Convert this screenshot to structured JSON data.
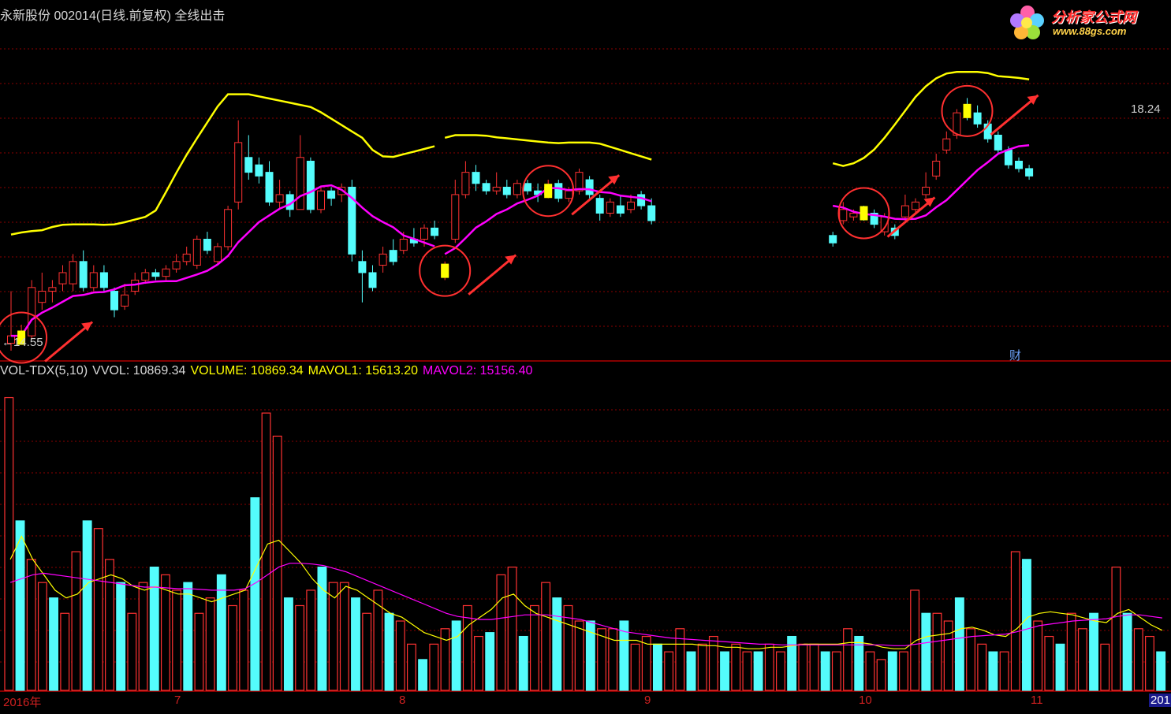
{
  "header": {
    "title": "永新股份 002014(日线.前复权) 全线出击"
  },
  "logo": {
    "name": "分析家公式网",
    "url": "www.88gs.com"
  },
  "price_labels": {
    "low": "←14.55",
    "high": "18.24"
  },
  "badge": "财",
  "vol_header": {
    "name": "VOL-TDX(5,10)",
    "vvol": "VVOL: 10869.34",
    "volume": "VOLUME: 10869.34",
    "mavol1": "MAVOL1: 15613.20",
    "mavol2": "MAVOL2: 15156.40"
  },
  "x_labels": [
    "2016年",
    "7",
    "8",
    "9",
    "10",
    "11",
    "201"
  ],
  "colors": {
    "background": "#000000",
    "up": "#ff3232",
    "down": "#54fcfc",
    "yellow_line": "#ffff00",
    "magenta_line": "#ff00ff",
    "signal": "#ffff00",
    "grid": "#8b0000",
    "volume_name": "#d8d8d8",
    "volume_value": "#ffff00",
    "mavol1": "#ffff00",
    "mavol2": "#ff00ff"
  },
  "chart_data": [
    {
      "type": "candlestick",
      "title": "永新股份 002014(日线.前复权) 全线出击",
      "ylim": [
        14.4,
        18.8
      ],
      "annotated_low": 14.55,
      "annotated_high": 18.24,
      "candles": [
        [
          14.5,
          14.6,
          15.2,
          14.4
        ],
        [
          14.55,
          14.6,
          14.75,
          14.55
        ],
        [
          14.6,
          15.25,
          15.35,
          14.55
        ],
        [
          15.05,
          15.2,
          15.45,
          14.95
        ],
        [
          15.2,
          15.25,
          15.35,
          15.05
        ],
        [
          15.3,
          15.45,
          15.55,
          15.2
        ],
        [
          15.3,
          15.6,
          15.7,
          15.2
        ],
        [
          15.6,
          15.25,
          15.75,
          15.2
        ],
        [
          15.25,
          15.45,
          15.55,
          15.2
        ],
        [
          15.45,
          15.25,
          15.55,
          15.2
        ],
        [
          15.2,
          14.95,
          15.25,
          14.85
        ],
        [
          15.0,
          15.15,
          15.3,
          14.95
        ],
        [
          15.2,
          15.35,
          15.45,
          15.15
        ],
        [
          15.35,
          15.45,
          15.5,
          15.3
        ],
        [
          15.45,
          15.4,
          15.5,
          15.35
        ],
        [
          15.4,
          15.5,
          15.55,
          15.35
        ],
        [
          15.5,
          15.6,
          15.7,
          15.45
        ],
        [
          15.6,
          15.7,
          15.8,
          15.55
        ],
        [
          15.55,
          15.9,
          15.95,
          15.5
        ],
        [
          15.9,
          15.75,
          16.0,
          15.7
        ],
        [
          15.6,
          15.8,
          15.85,
          15.55
        ],
        [
          15.8,
          16.3,
          16.35,
          15.75
        ],
        [
          16.4,
          17.2,
          17.5,
          16.3
        ],
        [
          17.0,
          16.8,
          17.3,
          16.7
        ],
        [
          16.9,
          16.75,
          17.0,
          16.65
        ],
        [
          16.8,
          16.4,
          16.95,
          16.35
        ],
        [
          16.4,
          16.5,
          16.7,
          16.3
        ],
        [
          16.5,
          16.3,
          16.55,
          16.2
        ],
        [
          16.3,
          17.0,
          17.3,
          16.3
        ],
        [
          16.95,
          16.3,
          17.0,
          16.25
        ],
        [
          16.3,
          16.55,
          16.6,
          16.25
        ],
        [
          16.55,
          16.45,
          16.6,
          16.35
        ],
        [
          16.5,
          16.6,
          16.65,
          16.4
        ],
        [
          16.6,
          15.7,
          16.7,
          15.6
        ],
        [
          15.6,
          15.45,
          15.75,
          15.05
        ],
        [
          15.45,
          15.25,
          15.55,
          15.2
        ],
        [
          15.55,
          15.7,
          15.8,
          15.45
        ],
        [
          15.75,
          15.6,
          15.9,
          15.55
        ],
        [
          15.75,
          15.9,
          16.0,
          15.7
        ],
        [
          15.9,
          15.85,
          16.05,
          15.8
        ],
        [
          15.9,
          16.05,
          16.1,
          15.8
        ],
        [
          16.05,
          15.95,
          16.15,
          15.9
        ],
        [
          15.4,
          15.55,
          15.6,
          15.35
        ],
        [
          15.9,
          16.5,
          16.7,
          15.85
        ],
        [
          16.5,
          16.8,
          16.95,
          16.45
        ],
        [
          16.8,
          16.65,
          16.9,
          16.55
        ],
        [
          16.65,
          16.55,
          16.7,
          16.5
        ],
        [
          16.55,
          16.6,
          16.8,
          16.5
        ],
        [
          16.6,
          16.5,
          16.7,
          16.45
        ],
        [
          16.5,
          16.65,
          16.7,
          16.45
        ],
        [
          16.65,
          16.55,
          16.7,
          16.5
        ],
        [
          16.55,
          16.5,
          16.65,
          16.4
        ],
        [
          16.5,
          16.6,
          16.7,
          16.45
        ],
        [
          16.65,
          16.45,
          16.7,
          16.4
        ],
        [
          16.45,
          16.55,
          16.6,
          16.4
        ],
        [
          16.55,
          16.8,
          16.85,
          16.5
        ],
        [
          16.7,
          16.5,
          16.75,
          16.45
        ],
        [
          16.45,
          16.25,
          16.5,
          16.15
        ],
        [
          16.25,
          16.4,
          16.45,
          16.2
        ],
        [
          16.35,
          16.25,
          16.5,
          16.2
        ],
        [
          16.3,
          16.4,
          16.5,
          16.25
        ],
        [
          16.5,
          16.35,
          16.55,
          16.3
        ],
        [
          16.35,
          16.15,
          16.45,
          16.1
        ],
        [
          15.95,
          15.85,
          16.0,
          15.8
        ],
        [
          16.15,
          16.3,
          16.4,
          16.1
        ],
        [
          16.2,
          16.25,
          16.3,
          16.15
        ],
        [
          16.3,
          16.2,
          16.35,
          16.15
        ],
        [
          16.25,
          16.1,
          16.3,
          16.05
        ],
        [
          16.0,
          16.2,
          16.25,
          15.95
        ],
        [
          16.05,
          15.95,
          16.1,
          15.9
        ],
        [
          16.2,
          16.35,
          16.5,
          16.15
        ],
        [
          16.3,
          16.4,
          16.45,
          16.25
        ],
        [
          16.5,
          16.6,
          16.8,
          16.45
        ],
        [
          16.75,
          16.95,
          17.05,
          16.7
        ],
        [
          17.1,
          17.25,
          17.35,
          17.05
        ],
        [
          17.3,
          17.6,
          17.65,
          17.25
        ],
        [
          17.7,
          17.55,
          17.8,
          17.5
        ],
        [
          17.6,
          17.45,
          17.7,
          17.4
        ],
        [
          17.45,
          17.25,
          17.5,
          17.2
        ],
        [
          17.3,
          17.1,
          17.35,
          17.05
        ],
        [
          17.1,
          16.9,
          17.15,
          16.85
        ],
        [
          16.95,
          16.85,
          17.0,
          16.8
        ],
        [
          16.85,
          16.75,
          16.9,
          16.7
        ]
      ]
    },
    {
      "type": "bar",
      "title": "VOL-TDX(5,10)",
      "ylim": [
        0,
        40000
      ],
      "volume_last": 10869.34,
      "mavol1_last": 15613.2,
      "mavol2_last": 15156.4,
      "volumes": [
        38000,
        22000,
        17000,
        14000,
        12000,
        10000,
        18000,
        22000,
        21000,
        17000,
        14000,
        10000,
        14000,
        16000,
        15000,
        13000,
        14000,
        10000,
        12000,
        15000,
        11000,
        13000,
        25000,
        36000,
        33000,
        12000,
        11000,
        13000,
        16000,
        14000,
        14000,
        12000,
        10000,
        13000,
        10000,
        9000,
        6000,
        4000,
        6000,
        8000,
        9000,
        11000,
        7000,
        7500,
        15000,
        16000,
        7000,
        11000,
        14000,
        12000,
        11000,
        9000,
        9000,
        8000,
        8000,
        9000,
        6000,
        7000,
        6000,
        5000,
        8000,
        5000,
        6000,
        7000,
        5000,
        6000,
        5000,
        5000,
        6000,
        5000,
        7000,
        6000,
        6000,
        5000,
        5000,
        8000,
        7000,
        5000,
        4000,
        5000,
        5000,
        13000,
        10000,
        10000,
        9000,
        12000,
        8000,
        6000,
        5000,
        5000,
        18000,
        17000,
        9000,
        7000,
        6000,
        10000,
        8000,
        10000,
        6000,
        16000,
        10000,
        8000,
        7000,
        5000
      ],
      "mavol1": [
        17000,
        20000,
        17000,
        15000,
        13000,
        12000,
        12500,
        14000,
        14500,
        15000,
        14500,
        13500,
        13000,
        13500,
        13000,
        12500,
        12500,
        12000,
        11500,
        12000,
        12500,
        13000,
        16000,
        19000,
        19500,
        18000,
        16500,
        14500,
        13000,
        12000,
        13500,
        13000,
        12000,
        11000,
        10000,
        9500,
        8500,
        7500,
        7000,
        6500,
        7000,
        8500,
        9500,
        10500,
        12000,
        12500,
        11000,
        10000,
        9500,
        9000,
        8500,
        8000,
        7500,
        7000,
        6500,
        6500,
        6500,
        6000,
        6000,
        6000,
        6000,
        6000,
        5800,
        5800,
        5600,
        5600,
        5400,
        5400,
        5600,
        5600,
        5800,
        6000,
        6000,
        6000,
        6000,
        6200,
        6200,
        6000,
        5600,
        5400,
        5400,
        6500,
        7000,
        7200,
        7400,
        8000,
        8200,
        7800,
        7200,
        7000,
        8000,
        9500,
        10000,
        10200,
        10000,
        9800,
        9400,
        9000,
        8800,
        10000,
        10500,
        9500,
        8500,
        7800
      ],
      "mavol2": [
        14000,
        14500,
        15000,
        15200,
        15000,
        14800,
        14600,
        14400,
        14200,
        14000,
        13800,
        13600,
        13400,
        13400,
        13300,
        13200,
        13200,
        13100,
        13000,
        13000,
        13000,
        13200,
        14000,
        15000,
        16000,
        16500,
        16500,
        16400,
        16200,
        15800,
        15400,
        14800,
        14200,
        13600,
        13000,
        12400,
        11800,
        11200,
        10600,
        10000,
        9600,
        9400,
        9200,
        9200,
        9400,
        9600,
        9800,
        9800,
        9800,
        9600,
        9400,
        9200,
        8800,
        8400,
        8000,
        7600,
        7400,
        7200,
        7000,
        6800,
        6700,
        6600,
        6500,
        6400,
        6300,
        6200,
        6100,
        6000,
        6000,
        5900,
        5900,
        5900,
        5900,
        5900,
        5900,
        5900,
        5900,
        5900,
        5900,
        5800,
        5800,
        6000,
        6200,
        6400,
        6600,
        6800,
        7000,
        7100,
        7200,
        7300,
        7600,
        8000,
        8400,
        8600,
        8800,
        9000,
        9100,
        9200,
        9300,
        9600,
        9800,
        9800,
        9600,
        9400
      ]
    }
  ]
}
